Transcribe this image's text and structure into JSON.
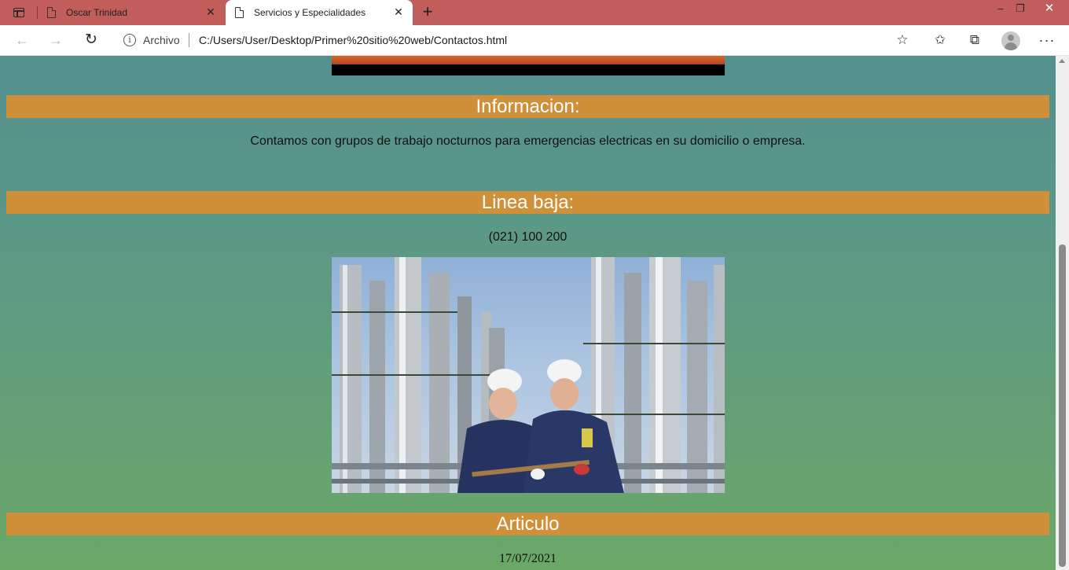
{
  "browser": {
    "tabs": [
      {
        "title": "Oscar Trinidad",
        "close": "✕"
      },
      {
        "title": "Servicios y Especialidades",
        "close": "✕"
      }
    ],
    "new_tab": "+",
    "window_controls": {
      "minimize": "–",
      "maximize": "❐",
      "close": "✕"
    },
    "address": {
      "security_label": "Archivo",
      "url": "C:/Users/User/Desktop/Primer%20sitio%20web/Contactos.html"
    },
    "icons": [
      "back-arrow-icon",
      "forward-arrow-icon",
      "reload-icon",
      "info-icon",
      "add-favorite-icon",
      "favorites-icon",
      "collections-icon",
      "profile-avatar",
      "more-icon"
    ],
    "accent_color": "#c15d5b"
  },
  "page": {
    "sections": {
      "informacion": {
        "heading": "Informacion:",
        "text": "Contamos con grupos de trabajo nocturnos para emergencias electricas en su domicilio o empresa."
      },
      "linea_baja": {
        "heading": "Linea baja:",
        "text": "(021) 100 200"
      },
      "articulo": {
        "heading": "Articulo",
        "date": "17/07/2021"
      }
    },
    "colors": {
      "heading_bar": "#d0903a",
      "background_top": "#54908f",
      "background_bottom": "#6aa868"
    }
  }
}
